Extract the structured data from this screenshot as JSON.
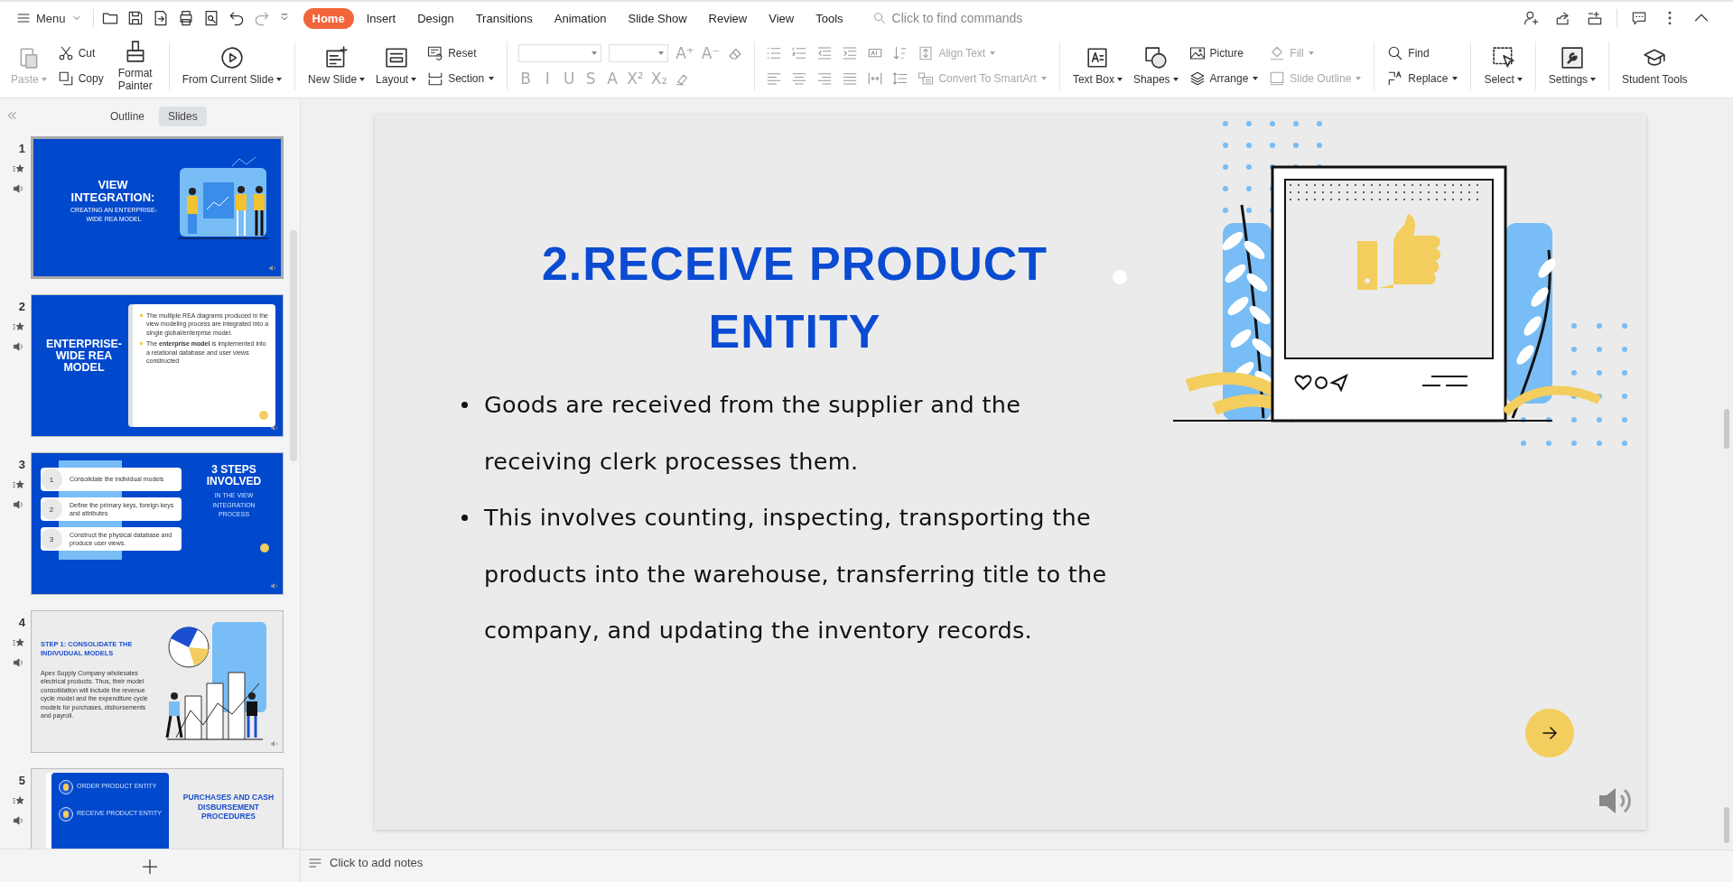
{
  "top_bar": {
    "menu_label": "Menu",
    "search_placeholder": "Click to find commands"
  },
  "tabs": [
    {
      "label": "Home",
      "selected": true
    },
    {
      "label": "Insert",
      "selected": false
    },
    {
      "label": "Design",
      "selected": false
    },
    {
      "label": "Transitions",
      "selected": false
    },
    {
      "label": "Animation",
      "selected": false
    },
    {
      "label": "Slide Show",
      "selected": false
    },
    {
      "label": "Review",
      "selected": false
    },
    {
      "label": "View",
      "selected": false
    },
    {
      "label": "Tools",
      "selected": false
    }
  ],
  "ribbon": [
    {
      "kind": "large",
      "label": "Paste",
      "dropdown": true,
      "disabled": true
    },
    {
      "kind": "stack",
      "items": [
        {
          "label": "Cut",
          "dropdown": false,
          "disabled": false
        },
        {
          "label": "Copy",
          "dropdown": false,
          "disabled": false
        }
      ]
    },
    {
      "kind": "large",
      "label": "Format Painter",
      "dropdown": false,
      "disabled": false
    },
    {
      "kind": "divider"
    },
    {
      "kind": "large",
      "label": "From Current Slide",
      "dropdown": true,
      "disabled": false
    },
    {
      "kind": "divider"
    },
    {
      "kind": "large",
      "label": "New Slide",
      "dropdown": true,
      "disabled": false
    },
    {
      "kind": "large",
      "label": "Layout",
      "dropdown": true,
      "disabled": false
    },
    {
      "kind": "stack",
      "items": [
        {
          "label": "Reset",
          "dropdown": false,
          "disabled": false
        },
        {
          "label": "Section",
          "dropdown": true,
          "disabled": false
        }
      ]
    },
    {
      "kind": "divider"
    },
    {
      "kind": "font_tools",
      "top": [
        "A⁺",
        "A⁻"
      ],
      "buttons": [
        "B",
        "I",
        "U",
        "S",
        "A",
        "X²",
        "X₂"
      ]
    },
    {
      "kind": "divider"
    },
    {
      "kind": "paragraph_tools"
    },
    {
      "kind": "stack",
      "items": [
        {
          "label": "Align Text",
          "dropdown": true,
          "disabled": true
        },
        {
          "label": "Convert To SmartArt",
          "dropdown": true,
          "disabled": true
        }
      ]
    },
    {
      "kind": "divider"
    },
    {
      "kind": "large",
      "label": "Text Box",
      "dropdown": true,
      "disabled": false
    },
    {
      "kind": "large",
      "label": "Shapes",
      "dropdown": true,
      "disabled": false
    },
    {
      "kind": "stack",
      "items": [
        {
          "label": "Picture",
          "dropdown": false,
          "disabled": false
        },
        {
          "label": "Arrange",
          "dropdown": true,
          "disabled": false
        }
      ]
    },
    {
      "kind": "stack",
      "items": [
        {
          "label": "Fill",
          "dropdown": true,
          "disabled": true
        },
        {
          "label": "Slide Outline",
          "dropdown": true,
          "disabled": true
        }
      ]
    },
    {
      "kind": "divider"
    },
    {
      "kind": "stack",
      "items": [
        {
          "label": "Find",
          "dropdown": false,
          "disabled": false
        },
        {
          "label": "Replace",
          "dropdown": true,
          "disabled": false
        }
      ]
    },
    {
      "kind": "divider"
    },
    {
      "kind": "large",
      "label": "Select",
      "dropdown": true,
      "disabled": false
    },
    {
      "kind": "divider"
    },
    {
      "kind": "large",
      "label": "Settings",
      "dropdown": true,
      "disabled": false
    },
    {
      "kind": "divider"
    },
    {
      "kind": "large",
      "label": "Student Tools",
      "dropdown": false,
      "disabled": false
    }
  ],
  "panel_tabs": [
    {
      "label": "Outline",
      "selected": false
    },
    {
      "label": "Slides",
      "selected": true
    }
  ],
  "slides": [
    {
      "number": "1",
      "selected": true,
      "kind": "title_people",
      "title": "VIEW INTEGRATION:",
      "subtitle": "CREATING AN ENTERPRISE-WIDE REA MODEL"
    },
    {
      "number": "2",
      "selected": false,
      "kind": "title_card",
      "title": "ENTERPRISE-WIDE REA MODEL",
      "bullets": [
        "The multiple REA diagrams produced in the view modeling process are integrated into a single global/enterprise model.",
        "The **enterprise model** is implemented into a relational database and user views constructed"
      ]
    },
    {
      "number": "3",
      "selected": false,
      "kind": "steps",
      "title": "3 STEPS INVOLVED",
      "subtitle": "IN THE VIEW INTEGRATION PROCESS",
      "steps": [
        {
          "number": "1",
          "text": "Consolidate the individual models"
        },
        {
          "number": "2",
          "text": "Define the primary keys, foreign keys and attributes"
        },
        {
          "number": "3",
          "text": "Construct the physical database and produce user views."
        }
      ]
    },
    {
      "number": "4",
      "selected": false,
      "kind": "illustration",
      "title": "STEP 1: CONSOLIDATE THE INDIVUDUAL MODELS",
      "body": "Apex Supply Company wholesales electrical products. Thus, their model consolidation will include the revenue cycle model and the expenditure cycle models for purchases, disbursements and payroll."
    },
    {
      "number": "5",
      "selected": false,
      "kind": "entities",
      "title": "PURCHASES AND CASH DISBURSEMENT PROCEDURES",
      "items": [
        "ORDER PRODUCT ENTITY",
        "RECEIVE PRODUCT ENTITY"
      ]
    }
  ],
  "current_slide": {
    "title": "2.RECEIVE PRODUCT ENTITY",
    "bullets": [
      "Goods are received from the supplier and the receiving clerk processes them.",
      "This involves counting, inspecting, transporting the products into the warehouse, transferring title to the company, and updating the inventory records."
    ]
  },
  "notes": {
    "placeholder": "Click to add notes"
  }
}
